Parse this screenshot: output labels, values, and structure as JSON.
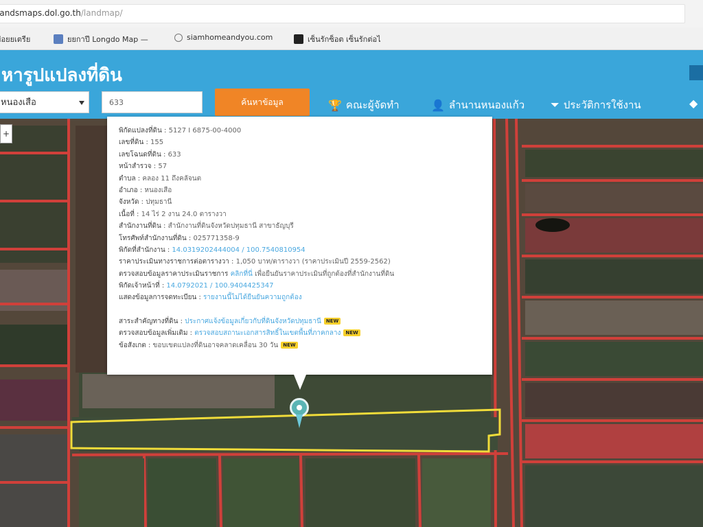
{
  "browser": {
    "url_host": "landsmaps.dol.go.th",
    "url_path": "/landmap/",
    "bookmarks": [
      {
        "label": "ข่อยยเตรีย",
        "icon": "bookmark-icon"
      },
      {
        "label": "ยยกาปี Longdo Map —",
        "icon": "map-icon"
      },
      {
        "label": "siamhomeandyou.com",
        "icon": "globe-icon"
      },
      {
        "label": "เซ็นรักซ็อต เซ็นรักต่อไ",
        "icon": "site-icon"
      }
    ]
  },
  "header": {
    "title": "หารูปแปลงที่ดิน",
    "province_select": "หนองเสือ",
    "parcel_input": "633",
    "search_button": "ค้นหาข้อมูล",
    "nav": [
      {
        "label": "คณะผู้จัดทำ",
        "icon": "trophy-icon"
      },
      {
        "label": "ลำนานหนองแก้ว",
        "icon": "user-icon"
      },
      {
        "label": "ประวัติการใช้งาน",
        "icon": "filter-icon"
      }
    ]
  },
  "map": {
    "control_label": "+"
  },
  "popup": {
    "rows": [
      {
        "label": "พิกัดแปลงที่ดิน",
        "value": "5127 I 6875-00-4000",
        "link": ""
      },
      {
        "label": "เลขที่ดิน",
        "value": "155",
        "link": ""
      },
      {
        "label": "เลขโฉนดที่ดิน",
        "value": "633",
        "link": ""
      },
      {
        "label": "หน้าสำรวจ",
        "value": "57",
        "link": ""
      },
      {
        "label": "ตำบล",
        "value": "คลอง 11 ถึงคลัจนต",
        "link": ""
      },
      {
        "label": "อำเภอ",
        "value": "หนองเสือ",
        "link": ""
      },
      {
        "label": "จังหวัด",
        "value": "ปทุมธานี",
        "link": ""
      },
      {
        "label": "เนื้อที่",
        "value": "14 ไร่ 2 งาน 24.0 ตารางวา",
        "link": ""
      },
      {
        "label": "สำนักงานที่ดิน",
        "value": "สำนักงานที่ดินจังหวัดปทุมธานี สาขาธัญบุรี",
        "link": ""
      },
      {
        "label": "โทรศัพท์สำนักงานที่ดิน",
        "value": "025771358-9",
        "link": ""
      },
      {
        "label": "พิกัดที่สำนักงาน",
        "value": "",
        "link": "14.0319202444004 / 100.7540810954"
      },
      {
        "label": "ราคาประเมินทางราชการต่อตารางวา",
        "value": "1,050 บาท/ตารางวา (ราคาประเมินปี 2559-2562)",
        "link": ""
      },
      {
        "label": "ตรวจสอบข้อมูลราคาประเมินราชการ",
        "value": "เพื่อยืนยันราคาประเมินที่ถูกต้องที่สำนักงานที่ดิน",
        "link": "คลิกที่นี่"
      },
      {
        "label": "พิกัดเจ้าหน้าที่",
        "value": "",
        "link": "14.0792021 / 100.9404425347"
      },
      {
        "label": "แสดงข้อมูลการจดทะเบียน",
        "value": "",
        "link": "รายงานนี้ไม่ได้ยืนยันความถูกต้อง"
      }
    ],
    "extra_rows": [
      {
        "label": "สาระสำคัญทางที่ดิน",
        "link": "ประกาศแจ้งข้อมูลเกี่ยวกับที่ดินจังหวัดปทุมธานี",
        "badge": "NEW"
      },
      {
        "label": "ตรวจสอบข้อมูลเพิ่มเติม",
        "link": "ตรวจสอบสถานะเอกสารสิทธิ์ในเขตพื้นที่ภาคกลาง",
        "badge": "NEW"
      },
      {
        "label": "ข้อสังเกต",
        "value": "ขอบเขตแปลงที่ดินอาจคลาดเคลื่อน 30 วัน",
        "badge": "NEW"
      }
    ]
  }
}
